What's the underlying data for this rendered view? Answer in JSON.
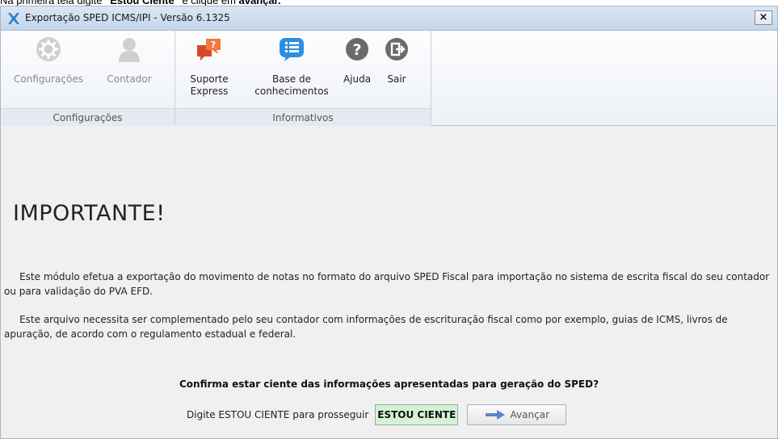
{
  "instruction": {
    "prefix": "Na primeira tela digite ",
    "keyword": "\"Estou Ciente\"",
    "middle": " e clique em ",
    "action": "avançar."
  },
  "window": {
    "title": "Exportação SPED ICMS/IPI  -  Versão 6.1325",
    "close_label": "×"
  },
  "ribbon": {
    "groups": [
      {
        "caption": "Configurações",
        "buttons": [
          {
            "label": "Configurações",
            "icon": "gear-icon",
            "enabled": false
          },
          {
            "label": "Contador",
            "icon": "person-icon",
            "enabled": false
          }
        ]
      },
      {
        "caption": "Informativos",
        "buttons": [
          {
            "label_line1": "Suporte",
            "label_line2": "Express",
            "icon": "support-chat-icon"
          },
          {
            "label_line1": "Base de",
            "label_line2": "conhecimentos",
            "icon": "knowledge-list-icon"
          },
          {
            "label": "Ajuda",
            "icon": "help-icon"
          },
          {
            "label": "Sair",
            "icon": "exit-icon"
          }
        ]
      }
    ]
  },
  "main": {
    "heading": "IMPORTANTE!",
    "paragraph1": "     Este módulo efetua a exportação do movimento de notas no formato do arquivo SPED Fiscal para importação no sistema de escrita fiscal do seu contador ou para validação do PVA EFD.",
    "paragraph2": "     Este arquivo necessita ser complementado pelo seu contador com informações de escrituração fiscal como por exemplo, guias de ICMS, livros de apuração, de acordo com o regulamento estadual e federal.",
    "confirm_question": "Confirma estar ciente das informações apresentadas para geração do SPED?",
    "entry_label": "Digite ESTOU CIENTE para prosseguir",
    "entry_value": "ESTOU CIENTE",
    "next_button": "Avançar"
  },
  "colors": {
    "input_bg": "#d6f2d6",
    "support_icon": "#e8542c",
    "knowledge_icon": "#2a8fe0",
    "help_icon": "#6b6b6b",
    "disabled_icon": "#c9c9c9"
  }
}
